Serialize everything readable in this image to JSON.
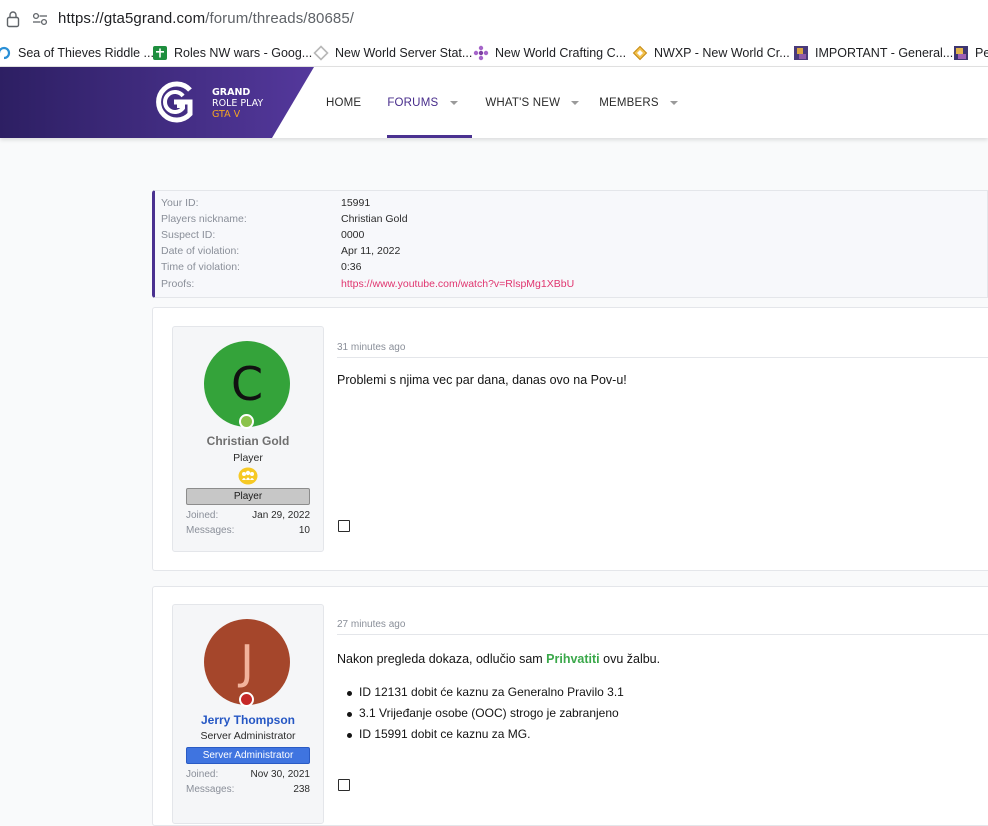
{
  "browser": {
    "url_host": "https://gta5grand.com",
    "url_path": "/forum/threads/80685/"
  },
  "bookmarks": [
    {
      "label": "Sea of Thieves Riddle ...",
      "icon": "sea-of-thieves-icon"
    },
    {
      "label": "Roles NW wars - Goog...",
      "icon": "sheets-icon"
    },
    {
      "label": "New World Server Stat...",
      "icon": "diamond-icon"
    },
    {
      "label": "New World Crafting C...",
      "icon": "flower-icon"
    },
    {
      "label": "NWXP - New World Cr...",
      "icon": "nwxp-icon"
    },
    {
      "label": "IMPORTANT - General...",
      "icon": "game-avatar-icon"
    },
    {
      "label": "Pe",
      "icon": "game-avatar-icon"
    }
  ],
  "site": {
    "logo_line1": "GRAND",
    "logo_line2": "ROLE PLAY",
    "logo_line3": "GTA V",
    "brand_color": "#4a3190"
  },
  "nav": [
    {
      "label": "HOME",
      "active": false,
      "dropdown": false
    },
    {
      "label": "FORUMS",
      "active": true,
      "dropdown": true
    },
    {
      "label": "WHAT'S NEW",
      "active": false,
      "dropdown": true
    },
    {
      "label": "MEMBERS",
      "active": false,
      "dropdown": true
    }
  ],
  "appeal": {
    "rows": [
      {
        "label": "Your ID:",
        "value": "15991"
      },
      {
        "label": "Players nickname:",
        "value": "Christian Gold"
      },
      {
        "label": "Suspect ID:",
        "value": "0000"
      },
      {
        "label": "Date of violation:",
        "value": "Apr 11, 2022"
      },
      {
        "label": "Time of violation:",
        "value": "0:36"
      },
      {
        "label": "Proofs:",
        "value": "https://www.youtube.com/watch?v=RlspMg1XBbU"
      }
    ]
  },
  "posts": [
    {
      "author": "Christian Gold",
      "avatar_letter": "C",
      "avatar_color": "#34a33a",
      "status_color": "#8bc34a",
      "user_title": "Player",
      "banner": "Player",
      "joined_label": "Joined:",
      "joined": "Jan 29, 2022",
      "messages_label": "Messages:",
      "messages": "10",
      "time": "31 minutes ago",
      "body": "Problemi s njima vec par dana, danas ovo na Pov-u!"
    },
    {
      "author": "Jerry Thompson",
      "avatar_letter": "J",
      "avatar_color": "#a5462b",
      "status_color": "#c62828",
      "user_title": "Server Administrator",
      "banner": "Server Administrator",
      "joined_label": "Joined:",
      "joined": "Nov 30, 2021",
      "messages_label": "Messages:",
      "messages": "238",
      "time": "27 minutes ago",
      "body_before": "Nakon pregleda dokaza, odlučio sam ",
      "body_accept": "Prihvatiti",
      "body_after": " ovu žalbu.",
      "items": [
        "ID 12131 dobit će kaznu za Generalno Pravilo 3.1",
        "3.1 Vrijeđanje osobe (OOC) strogo je zabranjeno",
        "ID 15991 dobit ce kaznu za MG."
      ]
    }
  ]
}
